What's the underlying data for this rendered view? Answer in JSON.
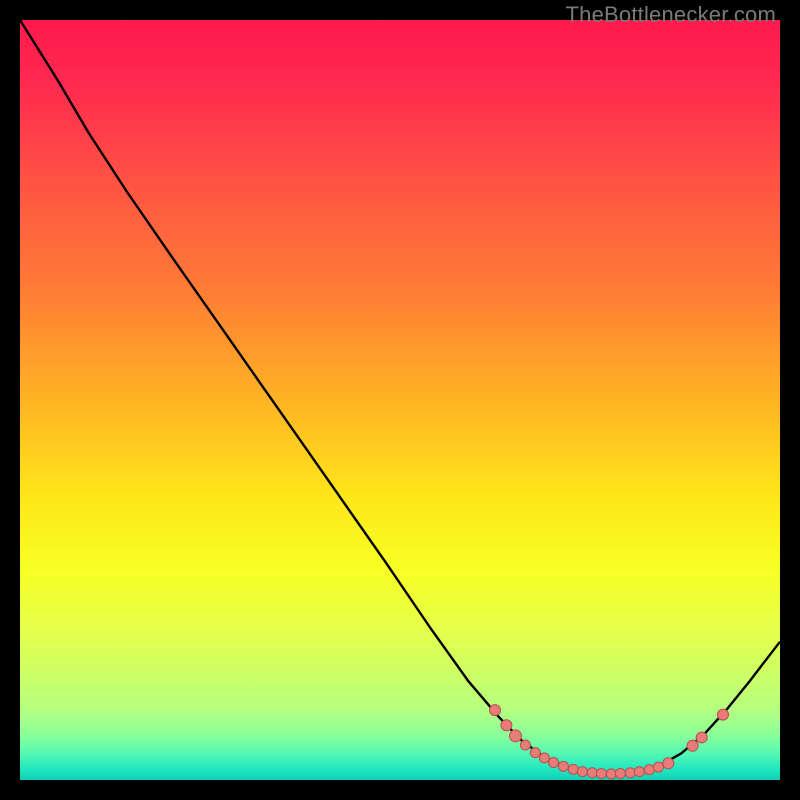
{
  "watermark": "TheBottlenecker.com",
  "colors": {
    "gradient_stops": [
      {
        "offset": 0,
        "color": "#ff1a4d"
      },
      {
        "offset": 0.08,
        "color": "#ff2850"
      },
      {
        "offset": 0.2,
        "color": "#ff4f44"
      },
      {
        "offset": 0.35,
        "color": "#ff7a36"
      },
      {
        "offset": 0.5,
        "color": "#ffb324"
      },
      {
        "offset": 0.62,
        "color": "#ffe41a"
      },
      {
        "offset": 0.72,
        "color": "#f8ff22"
      },
      {
        "offset": 0.8,
        "color": "#e6ff4a"
      },
      {
        "offset": 0.86,
        "color": "#ccff66"
      },
      {
        "offset": 0.905,
        "color": "#b6ff7e"
      },
      {
        "offset": 0.94,
        "color": "#8cff99"
      },
      {
        "offset": 0.965,
        "color": "#55f7b3"
      },
      {
        "offset": 0.985,
        "color": "#22e8c0"
      },
      {
        "offset": 1.0,
        "color": "#10cfb8"
      }
    ],
    "curve": "#000000",
    "dot_fill": "#e97b78",
    "dot_stroke": "#b94f4d"
  },
  "chart_data": {
    "type": "line",
    "title": "",
    "xlabel": "",
    "ylabel": "",
    "xlim": [
      0,
      100
    ],
    "ylim": [
      0,
      100
    ],
    "curve_points": [
      {
        "x": 0.0,
        "y": 100.0
      },
      {
        "x": 5.0,
        "y": 92.0
      },
      {
        "x": 9.0,
        "y": 85.2
      },
      {
        "x": 14.0,
        "y": 77.5
      },
      {
        "x": 20.0,
        "y": 68.8
      },
      {
        "x": 27.0,
        "y": 58.8
      },
      {
        "x": 34.0,
        "y": 48.8
      },
      {
        "x": 41.0,
        "y": 38.8
      },
      {
        "x": 48.0,
        "y": 28.8
      },
      {
        "x": 54.0,
        "y": 20.0
      },
      {
        "x": 59.0,
        "y": 13.0
      },
      {
        "x": 63.0,
        "y": 8.3
      },
      {
        "x": 66.0,
        "y": 5.2
      },
      {
        "x": 69.0,
        "y": 3.0
      },
      {
        "x": 72.0,
        "y": 1.7
      },
      {
        "x": 75.0,
        "y": 1.0
      },
      {
        "x": 78.0,
        "y": 0.8
      },
      {
        "x": 81.0,
        "y": 1.0
      },
      {
        "x": 84.0,
        "y": 1.8
      },
      {
        "x": 87.0,
        "y": 3.5
      },
      {
        "x": 90.0,
        "y": 6.0
      },
      {
        "x": 93.0,
        "y": 9.3
      },
      {
        "x": 96.0,
        "y": 13.0
      },
      {
        "x": 100.0,
        "y": 18.2
      }
    ],
    "dot_points": [
      {
        "x": 62.5,
        "y": 9.2,
        "r": 5.5
      },
      {
        "x": 64.0,
        "y": 7.2,
        "r": 5.5
      },
      {
        "x": 65.2,
        "y": 5.8,
        "r": 6.0
      },
      {
        "x": 66.5,
        "y": 4.6,
        "r": 5.0
      },
      {
        "x": 67.8,
        "y": 3.6,
        "r": 5.0
      },
      {
        "x": 69.0,
        "y": 2.9,
        "r": 5.0
      },
      {
        "x": 70.2,
        "y": 2.3,
        "r": 5.0
      },
      {
        "x": 71.5,
        "y": 1.8,
        "r": 5.0
      },
      {
        "x": 72.8,
        "y": 1.4,
        "r": 5.0
      },
      {
        "x": 74.0,
        "y": 1.1,
        "r": 5.0
      },
      {
        "x": 75.3,
        "y": 0.95,
        "r": 5.0
      },
      {
        "x": 76.5,
        "y": 0.85,
        "r": 5.0
      },
      {
        "x": 77.8,
        "y": 0.8,
        "r": 5.0
      },
      {
        "x": 79.0,
        "y": 0.85,
        "r": 5.0
      },
      {
        "x": 80.3,
        "y": 0.95,
        "r": 5.0
      },
      {
        "x": 81.5,
        "y": 1.1,
        "r": 5.0
      },
      {
        "x": 82.8,
        "y": 1.35,
        "r": 5.0
      },
      {
        "x": 84.0,
        "y": 1.7,
        "r": 5.0
      },
      {
        "x": 85.3,
        "y": 2.2,
        "r": 5.5
      },
      {
        "x": 88.5,
        "y": 4.5,
        "r": 5.5
      },
      {
        "x": 89.7,
        "y": 5.6,
        "r": 5.5
      },
      {
        "x": 92.5,
        "y": 8.6,
        "r": 5.5
      }
    ]
  }
}
